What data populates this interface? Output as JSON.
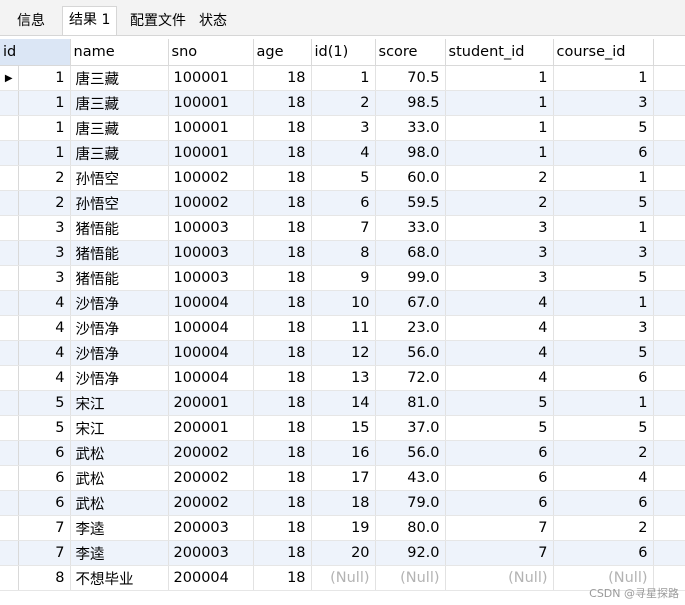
{
  "tabs": [
    {
      "label": "信息"
    },
    {
      "label": "结果 1"
    },
    {
      "label": "配置文件"
    },
    {
      "label": "状态"
    }
  ],
  "columns": [
    "id",
    "name",
    "sno",
    "age",
    "id(1)",
    "score",
    "student_id",
    "course_id"
  ],
  "rows": [
    [
      "1",
      "唐三藏",
      "100001",
      "18",
      "1",
      "70.5",
      "1",
      "1"
    ],
    [
      "1",
      "唐三藏",
      "100001",
      "18",
      "2",
      "98.5",
      "1",
      "3"
    ],
    [
      "1",
      "唐三藏",
      "100001",
      "18",
      "3",
      "33.0",
      "1",
      "5"
    ],
    [
      "1",
      "唐三藏",
      "100001",
      "18",
      "4",
      "98.0",
      "1",
      "6"
    ],
    [
      "2",
      "孙悟空",
      "100002",
      "18",
      "5",
      "60.0",
      "2",
      "1"
    ],
    [
      "2",
      "孙悟空",
      "100002",
      "18",
      "6",
      "59.5",
      "2",
      "5"
    ],
    [
      "3",
      "猪悟能",
      "100003",
      "18",
      "7",
      "33.0",
      "3",
      "1"
    ],
    [
      "3",
      "猪悟能",
      "100003",
      "18",
      "8",
      "68.0",
      "3",
      "3"
    ],
    [
      "3",
      "猪悟能",
      "100003",
      "18",
      "9",
      "99.0",
      "3",
      "5"
    ],
    [
      "4",
      "沙悟净",
      "100004",
      "18",
      "10",
      "67.0",
      "4",
      "1"
    ],
    [
      "4",
      "沙悟净",
      "100004",
      "18",
      "11",
      "23.0",
      "4",
      "3"
    ],
    [
      "4",
      "沙悟净",
      "100004",
      "18",
      "12",
      "56.0",
      "4",
      "5"
    ],
    [
      "4",
      "沙悟净",
      "100004",
      "18",
      "13",
      "72.0",
      "4",
      "6"
    ],
    [
      "5",
      "宋江",
      "200001",
      "18",
      "14",
      "81.0",
      "5",
      "1"
    ],
    [
      "5",
      "宋江",
      "200001",
      "18",
      "15",
      "37.0",
      "5",
      "5"
    ],
    [
      "6",
      "武松",
      "200002",
      "18",
      "16",
      "56.0",
      "6",
      "2"
    ],
    [
      "6",
      "武松",
      "200002",
      "18",
      "17",
      "43.0",
      "6",
      "4"
    ],
    [
      "6",
      "武松",
      "200002",
      "18",
      "18",
      "79.0",
      "6",
      "6"
    ],
    [
      "7",
      "李逵",
      "200003",
      "18",
      "19",
      "80.0",
      "7",
      "2"
    ],
    [
      "7",
      "李逵",
      "200003",
      "18",
      "20",
      "92.0",
      "7",
      "6"
    ],
    [
      "8",
      "不想毕业",
      "200004",
      "18",
      "(Null)",
      "(Null)",
      "(Null)",
      "(Null)"
    ]
  ],
  "current_row_marker": "▶",
  "watermark": "CSDN @寻星探路"
}
